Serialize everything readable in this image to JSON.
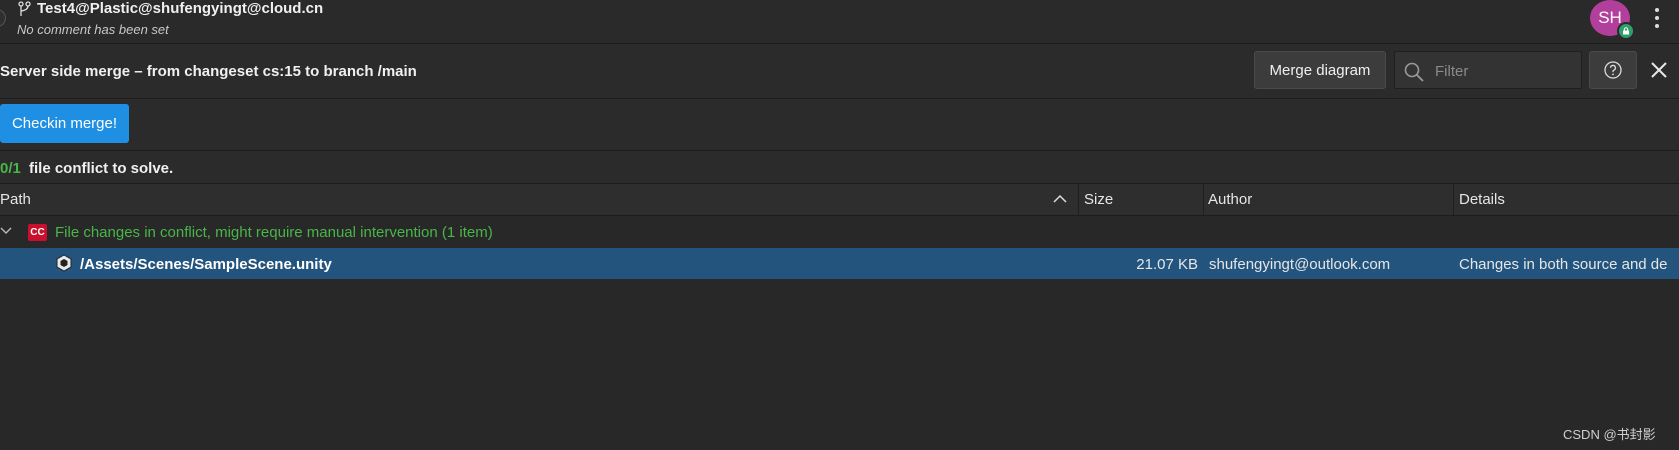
{
  "header": {
    "workspace_title": "Test4@Plastic@shufengyingt@cloud.cn",
    "comment": "No comment has been set",
    "avatar_initials": "SH"
  },
  "toolbar": {
    "merge_title": "Server side merge – from changeset cs:15 to branch /main",
    "merge_diagram_label": "Merge diagram",
    "filter_placeholder": "Filter"
  },
  "actions": {
    "checkin_label": "Checkin merge!"
  },
  "summary": {
    "count": "0/1",
    "text": "file conflict to solve."
  },
  "columns": [
    {
      "label": "Path"
    },
    {
      "label": "Size"
    },
    {
      "label": "Author"
    },
    {
      "label": "Details"
    }
  ],
  "group": {
    "badge": "CC",
    "label": "File changes in conflict, might require manual intervention (1 item)"
  },
  "rows": [
    {
      "path": "/Assets/Scenes/SampleScene.unity",
      "size": "21.07 KB",
      "author": "shufengyingt@outlook.com",
      "details": "Changes in both source and de"
    }
  ],
  "watermark": "CSDN @书封影",
  "colors": {
    "accent_blue": "#1e8fe3",
    "conflict_green": "#48b648",
    "selection": "#23547e",
    "avatar": "#b33f9c",
    "cc_badge": "#c8102e"
  }
}
